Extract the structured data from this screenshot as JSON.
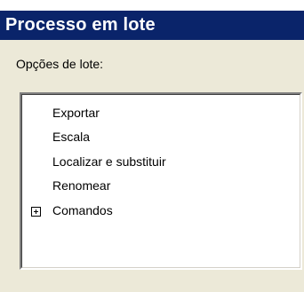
{
  "panel": {
    "title": "Processo em lote",
    "options_label": "Opções de lote:"
  },
  "list": {
    "items": [
      {
        "label": "Exportar"
      },
      {
        "label": "Escala"
      },
      {
        "label": "Localizar e substituir"
      },
      {
        "label": "Renomear"
      },
      {
        "label": "Comandos",
        "expander_icon": "plus-box-icon"
      }
    ]
  },
  "colors": {
    "title_bar": "#0a246a",
    "panel_background": "#ece9d8",
    "list_background": "#ffffff"
  }
}
